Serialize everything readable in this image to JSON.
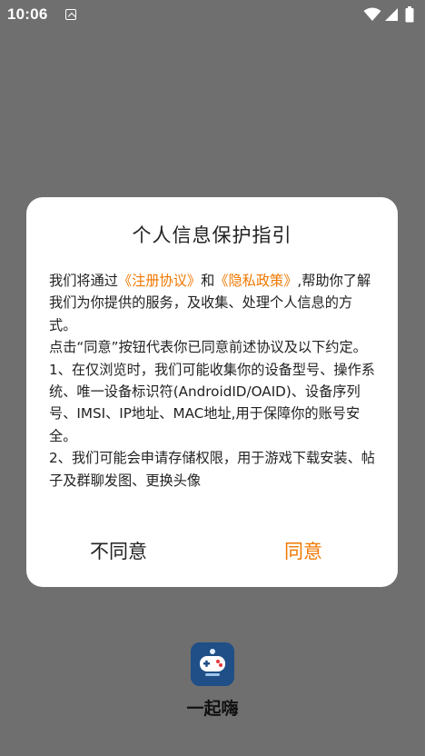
{
  "status_bar": {
    "time": "10:06",
    "notification_icon": "text-recognition-icon",
    "wifi_icon": "wifi-icon",
    "signal_icon": "cellular-signal-icon",
    "battery_icon": "battery-icon"
  },
  "dialog": {
    "title": "个人信息保护指引",
    "para1": {
      "pre": "我们将通过",
      "link1": "《注册协议》",
      "mid": "和",
      "link2": "《隐私政策》",
      "post": ",帮助你了解我们为你提供的服务，及收集、处理个人信息的方式。"
    },
    "para2": " 点击“同意”按钮代表你已同意前述协议及以下约定。",
    "para3": " 1、在仅浏览时，我们可能收集你的设备型号、操作系统、唯一设备标识符(AndroidID/OAID)、设备序列号、IMSI、IP地址、MAC地址,用于保障你的账号安全。",
    "para4": " 2、我们可能会申请存储权限，用于游戏下载安装、帖子及群聊发图、更换头像",
    "disagree_label": "不同意",
    "agree_label": "同意"
  },
  "background_app": {
    "name": "一起嗨",
    "icon": "game-controller-icon",
    "icon_color": "#1f4f86"
  },
  "colors": {
    "accent": "#f07800",
    "overlay": "#6f6f6f"
  }
}
